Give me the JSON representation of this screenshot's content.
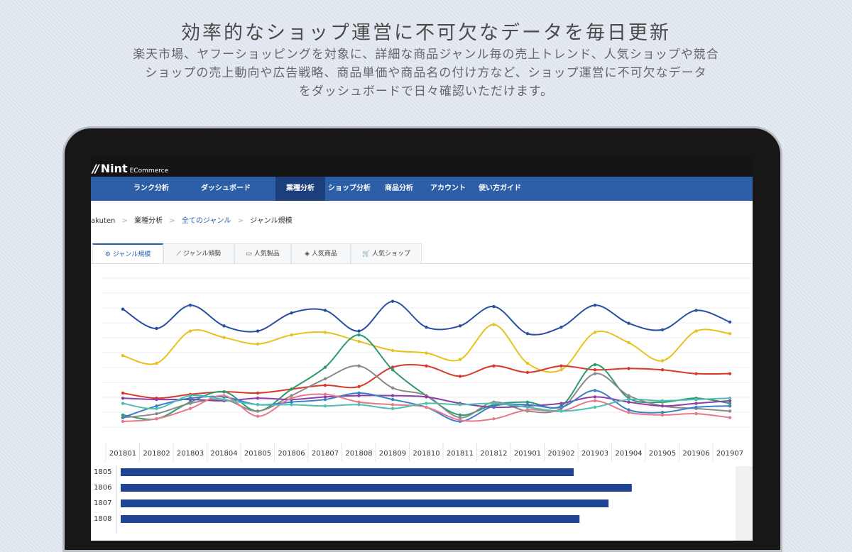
{
  "hero": {
    "title": "効率的なショップ運営に不可欠なデータを毎日更新",
    "subtitle_lines": [
      "楽天市場、ヤフーショッピングを対象に、詳細な商品ジャンル毎の売上トレンド、人気ショップや競合",
      "ショップの売上動向や広告戦略、商品単価や商品名の付け方など、ショップ運営に不可欠なデータ",
      "をダッシュボードで日々確認いただけます。"
    ]
  },
  "app": {
    "logo_text": "Nint",
    "logo_sub": "ECommerce",
    "nav": [
      "ランク分析",
      "ダッシュボード",
      "業種分析",
      "ショップ分析",
      "商品分析",
      "アカウント",
      "使い方ガイド"
    ],
    "nav_active_index": 2,
    "breadcrumb": [
      "akuten",
      "業種分析",
      "全てのジャンル",
      "ジャンル規模"
    ],
    "tabs": [
      {
        "label": "ジャンル規模",
        "icon": "gear-icon",
        "active": true
      },
      {
        "label": "ジャンル傾勢",
        "icon": "trend-icon",
        "active": false
      },
      {
        "label": "人気製品",
        "icon": "box-icon",
        "active": false
      },
      {
        "label": "人気商品",
        "icon": "tag-icon",
        "active": false
      },
      {
        "label": "人気ショップ",
        "icon": "cart-icon",
        "active": false
      }
    ]
  },
  "chart_data": [
    {
      "type": "line",
      "x": [
        "201801",
        "201802",
        "201803",
        "201804",
        "201805",
        "201806",
        "201807",
        "201808",
        "201809",
        "201810",
        "201811",
        "201812",
        "201901",
        "201902",
        "201903",
        "201904",
        "201905",
        "201906",
        "201907"
      ],
      "grid": true,
      "legend": "none",
      "series": [
        {
          "color": "#2a4fa0",
          "values": [
            87,
            72,
            90,
            74,
            70,
            84,
            86,
            70,
            93,
            73,
            74,
            89,
            68,
            73,
            90,
            76,
            71,
            86,
            77
          ]
        },
        {
          "color": "#e8c21c",
          "values": [
            51,
            45,
            70,
            65,
            60,
            67,
            69,
            62,
            55,
            53,
            48,
            75,
            45,
            40,
            69,
            61,
            47,
            70,
            68
          ]
        },
        {
          "color": "#d9392b",
          "values": [
            22,
            18,
            21,
            23,
            22,
            25,
            28,
            27,
            42,
            43,
            35,
            43,
            38,
            43,
            40,
            41,
            40,
            37,
            37
          ]
        },
        {
          "color": "#2f9a6e",
          "values": [
            5,
            2,
            15,
            23,
            8,
            25,
            42,
            67,
            40,
            20,
            5,
            13,
            15,
            12,
            44,
            18,
            15,
            18,
            14
          ]
        },
        {
          "color": "#8a8a8a",
          "values": [
            3,
            6,
            14,
            17,
            8,
            20,
            33,
            43,
            26,
            20,
            3,
            15,
            8,
            10,
            37,
            20,
            12,
            10,
            8
          ]
        },
        {
          "color": "#8e3fa6",
          "values": [
            18,
            17,
            17,
            16,
            18,
            17,
            19,
            20,
            20,
            19,
            14,
            11,
            12,
            14,
            19,
            15,
            12,
            14,
            16
          ]
        },
        {
          "color": "#3a7fc8",
          "values": [
            3,
            12,
            18,
            19,
            13,
            15,
            17,
            22,
            17,
            11,
            0,
            12,
            13,
            11,
            24,
            9,
            7,
            11,
            12
          ]
        },
        {
          "color": "#e57b8a",
          "values": [
            0,
            2,
            10,
            20,
            4,
            18,
            21,
            15,
            13,
            11,
            1,
            2,
            9,
            8,
            16,
            7,
            5,
            6,
            3
          ]
        },
        {
          "color": "#4fc0b0",
          "values": [
            14,
            10,
            20,
            17,
            13,
            13,
            12,
            13,
            10,
            14,
            13,
            14,
            11,
            8,
            11,
            17,
            16,
            17,
            18
          ]
        }
      ]
    },
    {
      "type": "bar",
      "orientation": "horizontal",
      "categories": [
        "1805",
        "1806",
        "1807",
        "1808"
      ],
      "values": [
        78,
        88,
        84,
        79
      ],
      "xlim": [
        0,
        100
      ],
      "color": "#1f4592"
    }
  ]
}
